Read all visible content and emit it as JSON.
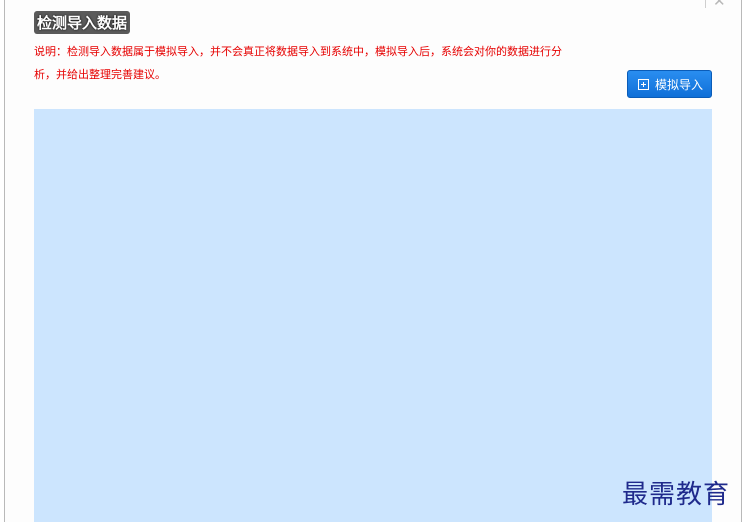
{
  "dialog": {
    "title": "检测导入数据",
    "description": "说明：检测导入数据属于模拟导入，并不会真正将数据导入到系统中，模拟导入后，系统会对你的数据进行分析，并给出整理完善建议。",
    "close_glyph": "✕"
  },
  "toolbar": {
    "import_label": "模拟导入"
  },
  "watermark": {
    "text": "最需教育"
  },
  "colors": {
    "accent": "#1b7ee6",
    "warning_text": "#e60000",
    "data_area": "#cce5fe"
  }
}
